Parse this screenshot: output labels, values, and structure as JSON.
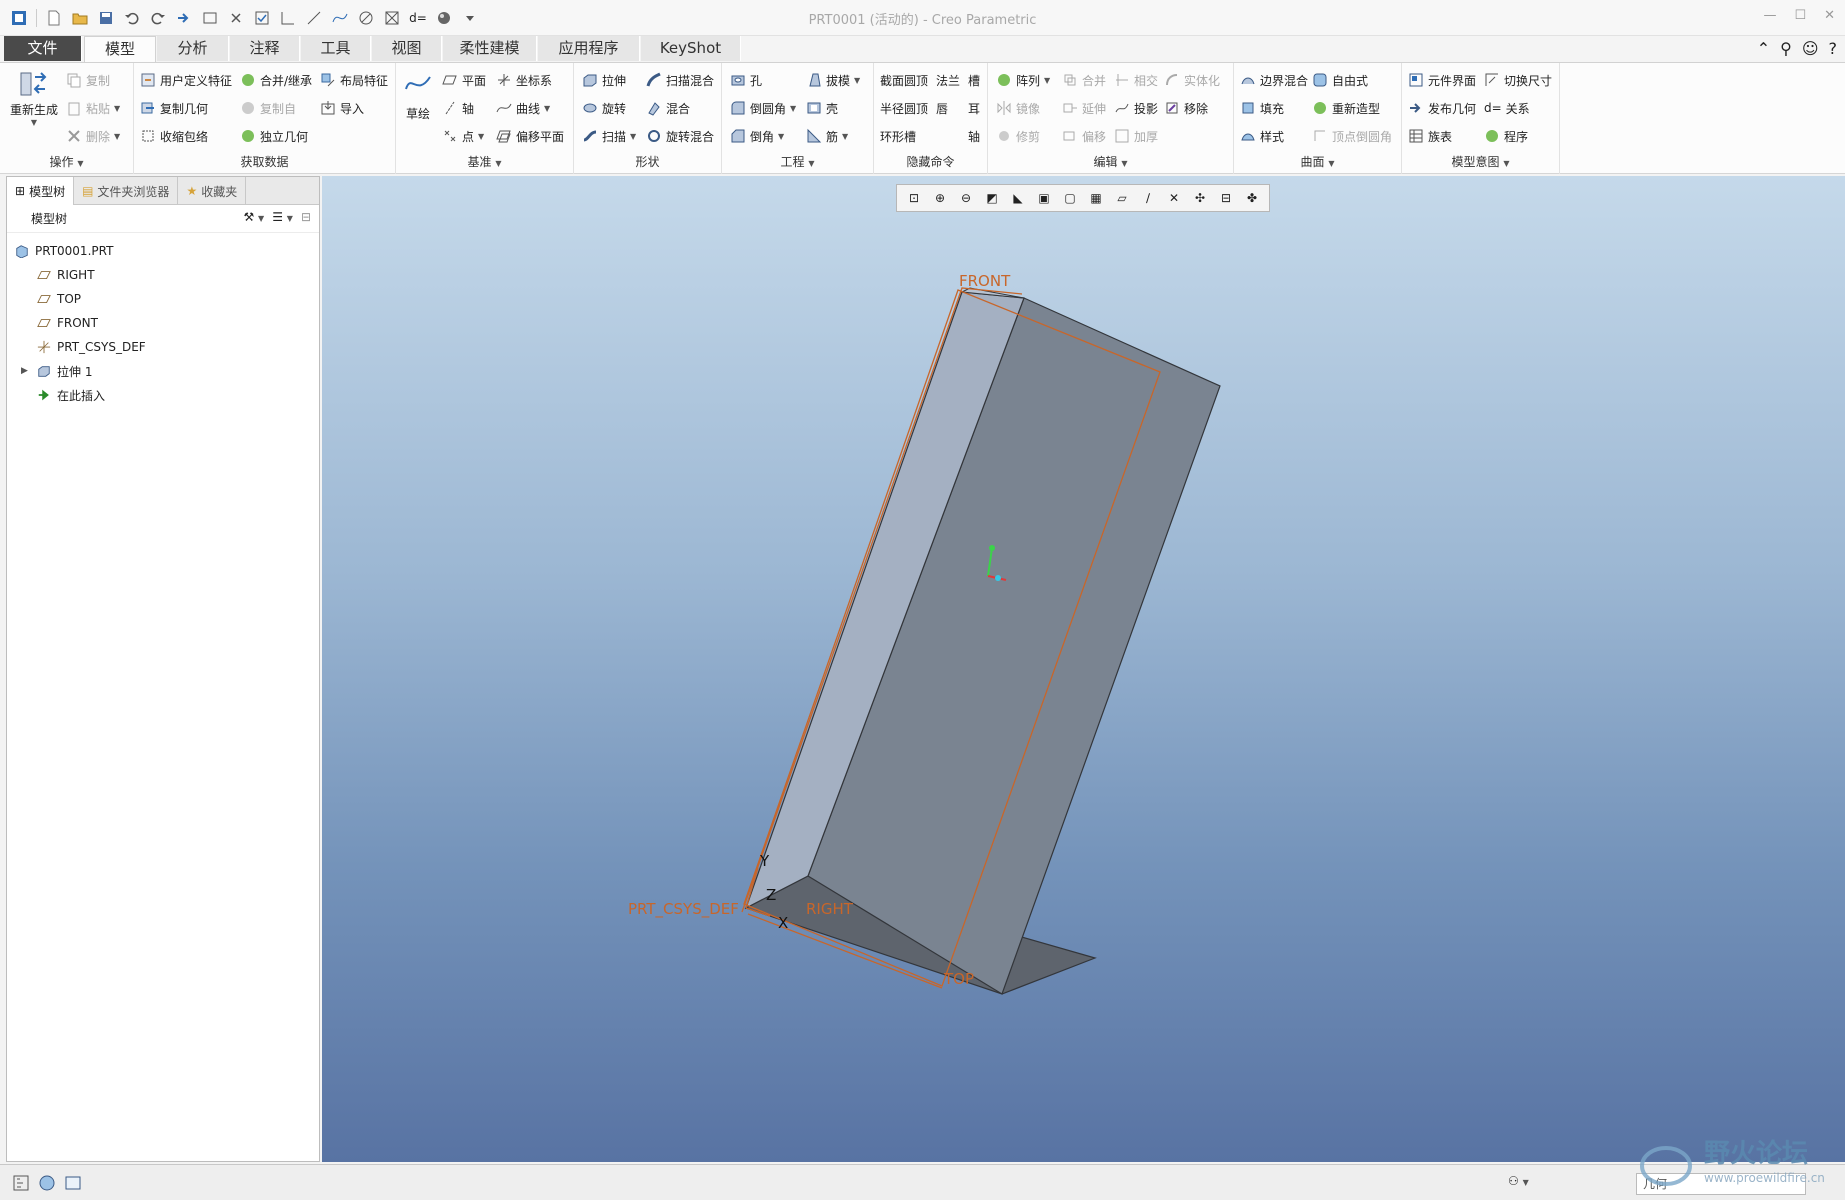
{
  "window": {
    "title": "PRT0001 (活动的) - Creo Parametric",
    "controls": [
      "—",
      "☐",
      "✕"
    ]
  },
  "tabs": [
    {
      "label": "文件"
    },
    {
      "label": "模型"
    },
    {
      "label": "分析"
    },
    {
      "label": "注释"
    },
    {
      "label": "工具"
    },
    {
      "label": "视图"
    },
    {
      "label": "柔性建模"
    },
    {
      "label": "应用程序"
    },
    {
      "label": "KeyShot"
    }
  ],
  "ribbon": {
    "groups": {
      "operations": "操作",
      "get_data": "获取数据",
      "datum": "基准",
      "shapes": "形状",
      "engineering": "工程",
      "hidden": "隐藏命令",
      "editing": "编辑",
      "surfaces": "曲面",
      "intent": "模型意图"
    },
    "operations": {
      "regenerate": "重新生成",
      "copy": "复制",
      "paste": "粘贴",
      "delete": "删除"
    },
    "get_data": {
      "udf": "用户定义特征",
      "merge": "合并/继承",
      "layout": "布局特征",
      "copy_geom": "复制几何",
      "copy_from": "复制自",
      "import": "导入",
      "shrinkwrap": "收缩包络",
      "indep_geom": "独立几何"
    },
    "datum": {
      "sketch": "草绘",
      "plane": "平面",
      "csys": "坐标系",
      "axis": "轴",
      "curve": "曲线",
      "point": "点",
      "offset_plane": "偏移平面"
    },
    "shapes": {
      "extrude": "拉伸",
      "sweep_blend": "扫描混合",
      "revolve": "旋转",
      "blend": "混合",
      "sweep": "扫描",
      "rot_blend": "旋转混合"
    },
    "engineering": {
      "hole": "孔",
      "draft": "拔模",
      "round": "倒圆角",
      "shell": "壳",
      "chamfer": "倒角",
      "rib": "筋"
    },
    "hidden": {
      "sect_dome": "截面圆顶",
      "flange": "法兰",
      "slot": "槽",
      "radius_dome": "半径圆顶",
      "lip": "唇",
      "ear": "耳",
      "toroidal": "环形槽",
      "shaft": "轴"
    },
    "editing": {
      "pattern": "阵列",
      "merge": "合并",
      "intersect": "相交",
      "solidify": "实体化",
      "mirror": "镜像",
      "extend": "延伸",
      "project": "投影",
      "remove": "移除",
      "trim": "修剪",
      "offset": "偏移",
      "thicken": "加厚"
    },
    "surfaces": {
      "boundary": "边界混合",
      "freestyle": "自由式",
      "fill": "填充",
      "restyle": "重新造型",
      "style": "样式",
      "vertex_round": "顶点倒圆角"
    },
    "intent": {
      "comp_interface": "元件界面",
      "toggle_dims": "切换尺寸",
      "publish_geom": "发布几何",
      "relations": "关系",
      "family_table": "族表",
      "program": "程序",
      "relations_prefix": "d="
    }
  },
  "panel": {
    "tabs": [
      "模型树",
      "文件夹浏览器",
      "收藏夹"
    ],
    "toolbar_label": "模型树",
    "tree": [
      {
        "label": "PRT0001.PRT",
        "icon": "part-icon",
        "indent": 0
      },
      {
        "label": "RIGHT",
        "icon": "datum-plane-icon",
        "indent": 1
      },
      {
        "label": "TOP",
        "icon": "datum-plane-icon",
        "indent": 1
      },
      {
        "label": "FRONT",
        "icon": "datum-plane-icon",
        "indent": 1
      },
      {
        "label": "PRT_CSYS_DEF",
        "icon": "csys-icon",
        "indent": 1
      },
      {
        "label": "拉伸 1",
        "icon": "extrude-icon",
        "indent": 1
      },
      {
        "label": "在此插入",
        "icon": "insert-arrow-icon",
        "indent": 1
      }
    ]
  },
  "viewport": {
    "labels": {
      "front": "FRONT",
      "right": "RIGHT",
      "top": "TOP",
      "csys": "PRT_CSYS_DEF",
      "x": "X",
      "y": "Y",
      "z": "Z"
    }
  },
  "status": {
    "filter": "几何"
  },
  "watermark": {
    "text": "野火论坛",
    "url": "www.proewildfire.cn"
  },
  "colors": {
    "datum": "#c8662a",
    "face_front": "#a4b0c2",
    "face_side": "#7a8491",
    "face_bottom": "#5e646d",
    "accent": "#4a4a4a"
  }
}
